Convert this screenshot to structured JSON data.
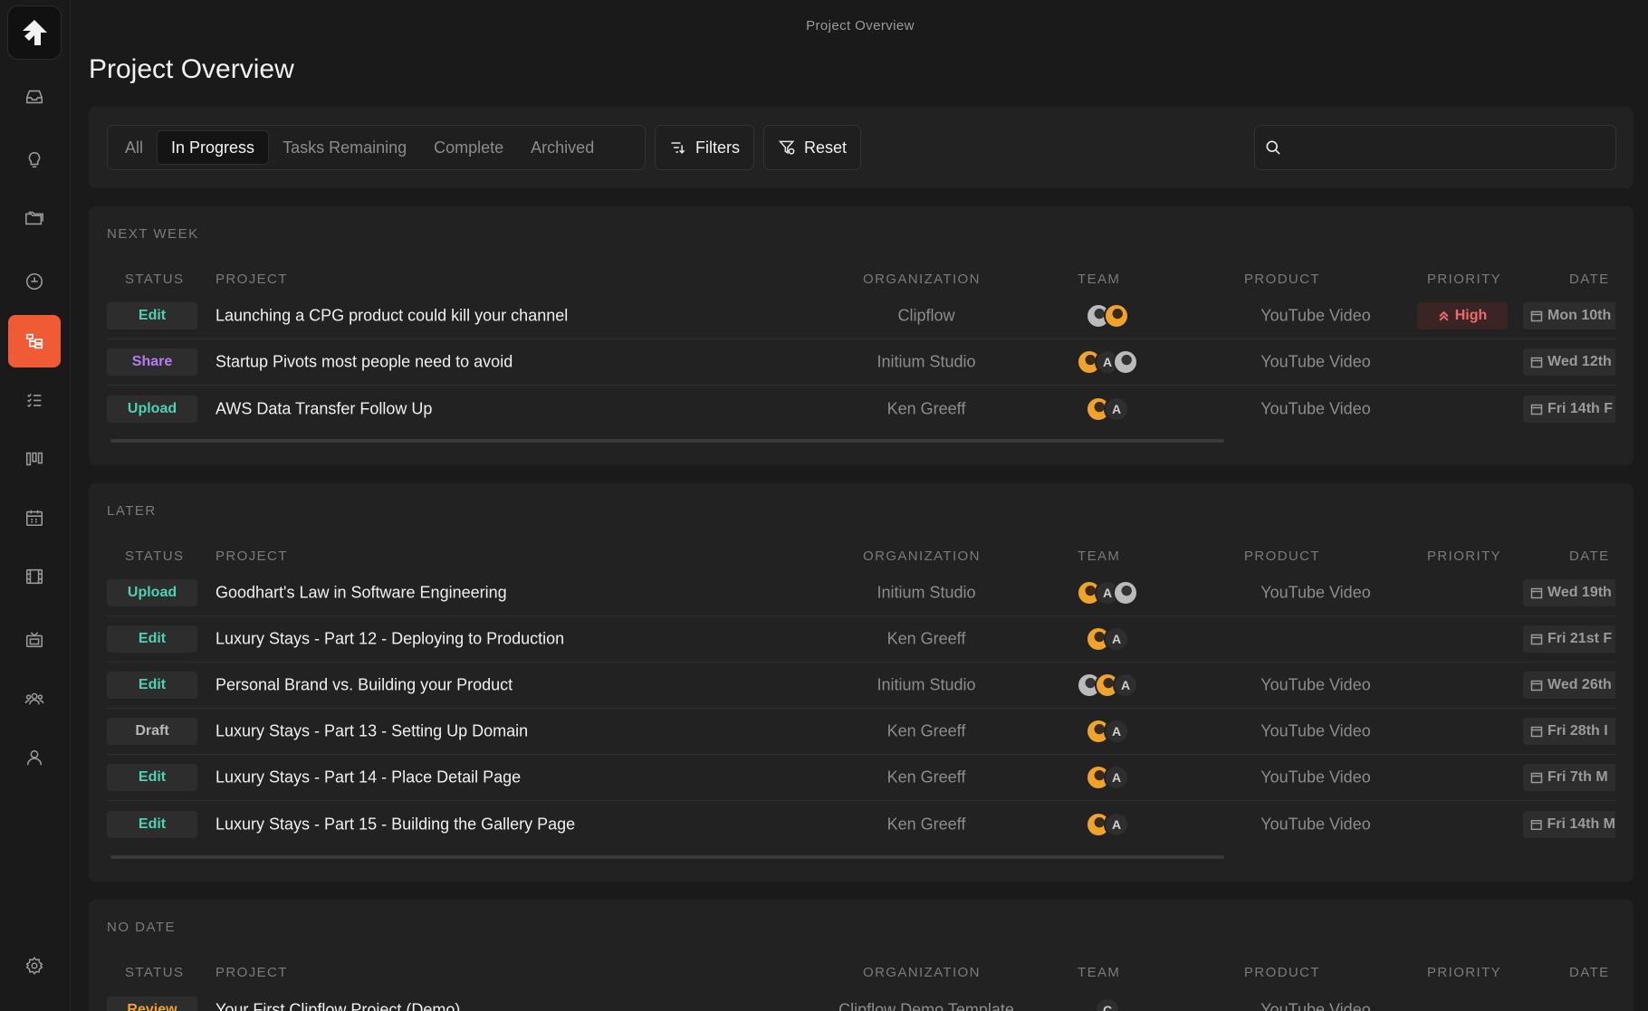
{
  "window_title": "Project Overview",
  "page_title": "Project Overview",
  "colors": {
    "accent": "#f05a35",
    "edit": "#4fd1b4",
    "share": "#b77cf0",
    "upload": "#4fd1b4",
    "draft": "#b8b8b8",
    "review": "#f0a32b",
    "high": "#ef6b6b"
  },
  "sidebar": {
    "icons": [
      "logo-icon",
      "inbox-icon",
      "lightbulb-icon",
      "folders-icon",
      "speedometer-icon",
      "project-tree-icon",
      "checklist-icon",
      "kanban-icon",
      "calendar-icon",
      "film-icon",
      "tv-icon",
      "team-icon",
      "user-icon",
      "settings-icon"
    ],
    "active": "project-tree-icon"
  },
  "toolbar": {
    "tabs": [
      "All",
      "In Progress",
      "Tasks Remaining",
      "Complete",
      "Archived"
    ],
    "active_tab": "In Progress",
    "filters_label": "Filters",
    "reset_label": "Reset",
    "search_value": ""
  },
  "columns": [
    "STATUS",
    "PROJECT",
    "ORGANIZATION",
    "TEAM",
    "PRODUCT",
    "PRIORITY",
    "DATE"
  ],
  "sections": [
    {
      "label": "NEXT WEEK",
      "rows": [
        {
          "status": "Edit",
          "project": "Launching a CPG product could kill your channel",
          "organization": "Clipflow",
          "team": [
            "gray",
            "orange"
          ],
          "product": "YouTube Video",
          "priority": "High",
          "date": "Mon 10th"
        },
        {
          "status": "Share",
          "project": "Startup Pivots most people need to avoid",
          "organization": "Initium Studio",
          "team": [
            "orange",
            "A",
            "gray"
          ],
          "product": "YouTube Video",
          "priority": "",
          "date": "Wed 12th"
        },
        {
          "status": "Upload",
          "project": "AWS Data Transfer Follow Up",
          "organization": "Ken Greeff",
          "team": [
            "orange",
            "A"
          ],
          "product": "YouTube Video",
          "priority": "",
          "date": "Fri 14th F"
        }
      ]
    },
    {
      "label": "LATER",
      "rows": [
        {
          "status": "Upload",
          "project": "Goodhart's Law in Software Engineering",
          "organization": "Initium Studio",
          "team": [
            "orange",
            "A",
            "gray"
          ],
          "product": "YouTube Video",
          "priority": "",
          "date": "Wed 19th"
        },
        {
          "status": "Edit",
          "project": "Luxury Stays - Part 12 - Deploying to Production",
          "organization": "Ken Greeff",
          "team": [
            "orange",
            "A"
          ],
          "product": "",
          "priority": "",
          "date": "Fri 21st F"
        },
        {
          "status": "Edit",
          "project": "Personal Brand vs. Building your Product",
          "organization": "Initium Studio",
          "team": [
            "gray",
            "orange",
            "A"
          ],
          "product": "YouTube Video",
          "priority": "",
          "date": "Wed 26th"
        },
        {
          "status": "Draft",
          "project": "Luxury Stays - Part 13 - Setting Up Domain",
          "organization": "Ken Greeff",
          "team": [
            "orange",
            "A"
          ],
          "product": "YouTube Video",
          "priority": "",
          "date": "Fri 28th I"
        },
        {
          "status": "Edit",
          "project": "Luxury Stays - Part 14 - Place Detail Page",
          "organization": "Ken Greeff",
          "team": [
            "orange",
            "A"
          ],
          "product": "YouTube Video",
          "priority": "",
          "date": "Fri 7th M"
        },
        {
          "status": "Edit",
          "project": "Luxury Stays - Part 15 - Building the Gallery Page",
          "organization": "Ken Greeff",
          "team": [
            "orange",
            "A"
          ],
          "product": "YouTube Video",
          "priority": "",
          "date": "Fri 14th M"
        }
      ]
    },
    {
      "label": "NO DATE",
      "rows": [
        {
          "status": "Review",
          "project": "Your First Clipflow Project (Demo)",
          "organization": "Clipflow Demo Template",
          "team": [
            "C"
          ],
          "product": "YouTube Video",
          "priority": "",
          "date": ""
        }
      ]
    }
  ]
}
